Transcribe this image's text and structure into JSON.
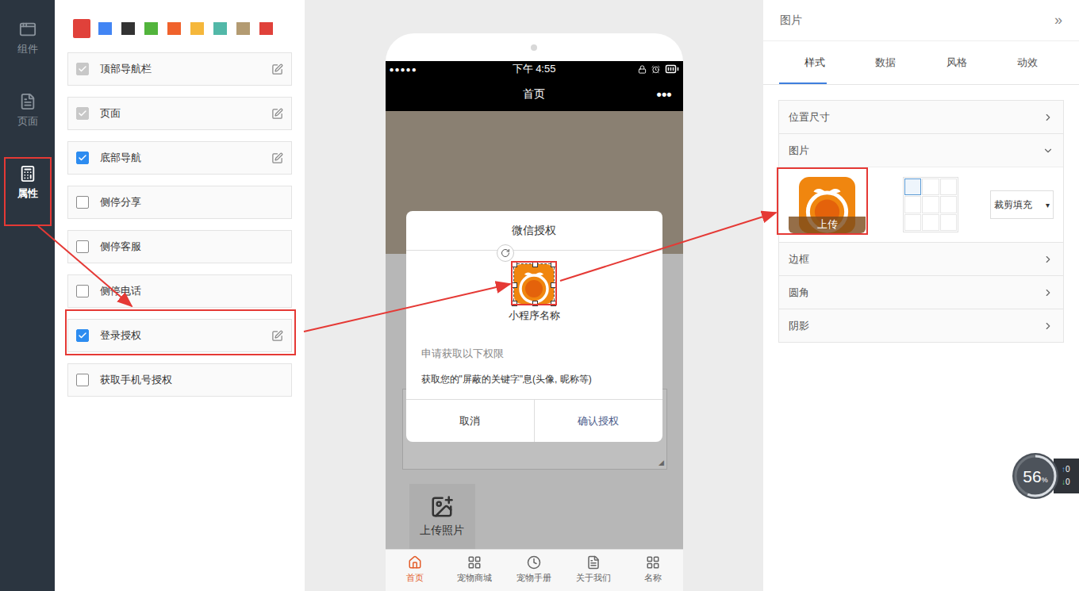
{
  "sidebar": {
    "items": [
      {
        "label": "组件",
        "selected": false
      },
      {
        "label": "页面",
        "selected": false
      },
      {
        "label": "属性",
        "selected": true
      }
    ]
  },
  "swatches": [
    {
      "color": "#e0413a",
      "selected": true
    },
    {
      "color": "#4285f4",
      "selected": false
    },
    {
      "color": "#333333",
      "selected": false
    },
    {
      "color": "#52b43c",
      "selected": false
    },
    {
      "color": "#f0622c",
      "selected": false
    },
    {
      "color": "#f5b73b",
      "selected": false
    },
    {
      "color": "#52b8a8",
      "selected": false
    },
    {
      "color": "#b39b72",
      "selected": false
    },
    {
      "color": "#e0413a",
      "selected": false
    }
  ],
  "options": [
    {
      "label": "顶部导航栏",
      "checked": true,
      "disabled": true,
      "editable": true
    },
    {
      "label": "页面",
      "checked": true,
      "disabled": true,
      "editable": true
    },
    {
      "label": "底部导航",
      "checked": true,
      "disabled": false,
      "editable": true
    },
    {
      "label": "侧停分享",
      "checked": false,
      "disabled": false,
      "editable": false
    },
    {
      "label": "侧停客服",
      "checked": false,
      "disabled": false,
      "editable": false
    },
    {
      "label": "侧停电话",
      "checked": false,
      "disabled": false,
      "editable": false
    },
    {
      "label": "登录授权",
      "checked": true,
      "disabled": false,
      "editable": true
    },
    {
      "label": "获取手机号授权",
      "checked": false,
      "disabled": false,
      "editable": false
    }
  ],
  "phone": {
    "status_bar": {
      "signal": "●●●●●",
      "time": "下午 4:55"
    },
    "nav": {
      "title": "首页",
      "menu": "•••"
    },
    "upload": {
      "label": "上传照片"
    },
    "dialog": {
      "title": "微信授权",
      "app_name": "小程序名称",
      "heading": "申请获取以下权限",
      "permission": "获取您的\"屏蔽的关键字\"息(头像, 昵称等)",
      "buttons": [
        "取消",
        "确认授权"
      ]
    },
    "tabbar": [
      {
        "label": "首页",
        "selected": true
      },
      {
        "label": "宠物商城",
        "selected": false
      },
      {
        "label": "宠物手册",
        "selected": false
      },
      {
        "label": "关于我们",
        "selected": false
      },
      {
        "label": "名称",
        "selected": false
      }
    ]
  },
  "properties": {
    "title": "图片",
    "collapse": "»",
    "tabs": [
      {
        "label": "样式",
        "selected": true
      },
      {
        "label": "数据",
        "selected": false
      },
      {
        "label": "风格",
        "selected": false
      },
      {
        "label": "动效",
        "selected": false
      }
    ],
    "sections": [
      {
        "label": "位置尺寸",
        "expanded": false
      },
      {
        "label": "图片",
        "expanded": true
      },
      {
        "label": "边框",
        "expanded": false
      },
      {
        "label": "圆角",
        "expanded": false
      },
      {
        "label": "阴影",
        "expanded": false
      }
    ],
    "image": {
      "upload": "上传",
      "grid": [
        true,
        false,
        false,
        false,
        false,
        false,
        false,
        false,
        false
      ],
      "fit": "裁剪填充",
      "fit_arrow": "▾"
    }
  },
  "monitor": {
    "value": "56",
    "unit": "%",
    "level": 0.56,
    "up": "0",
    "down": "0"
  }
}
